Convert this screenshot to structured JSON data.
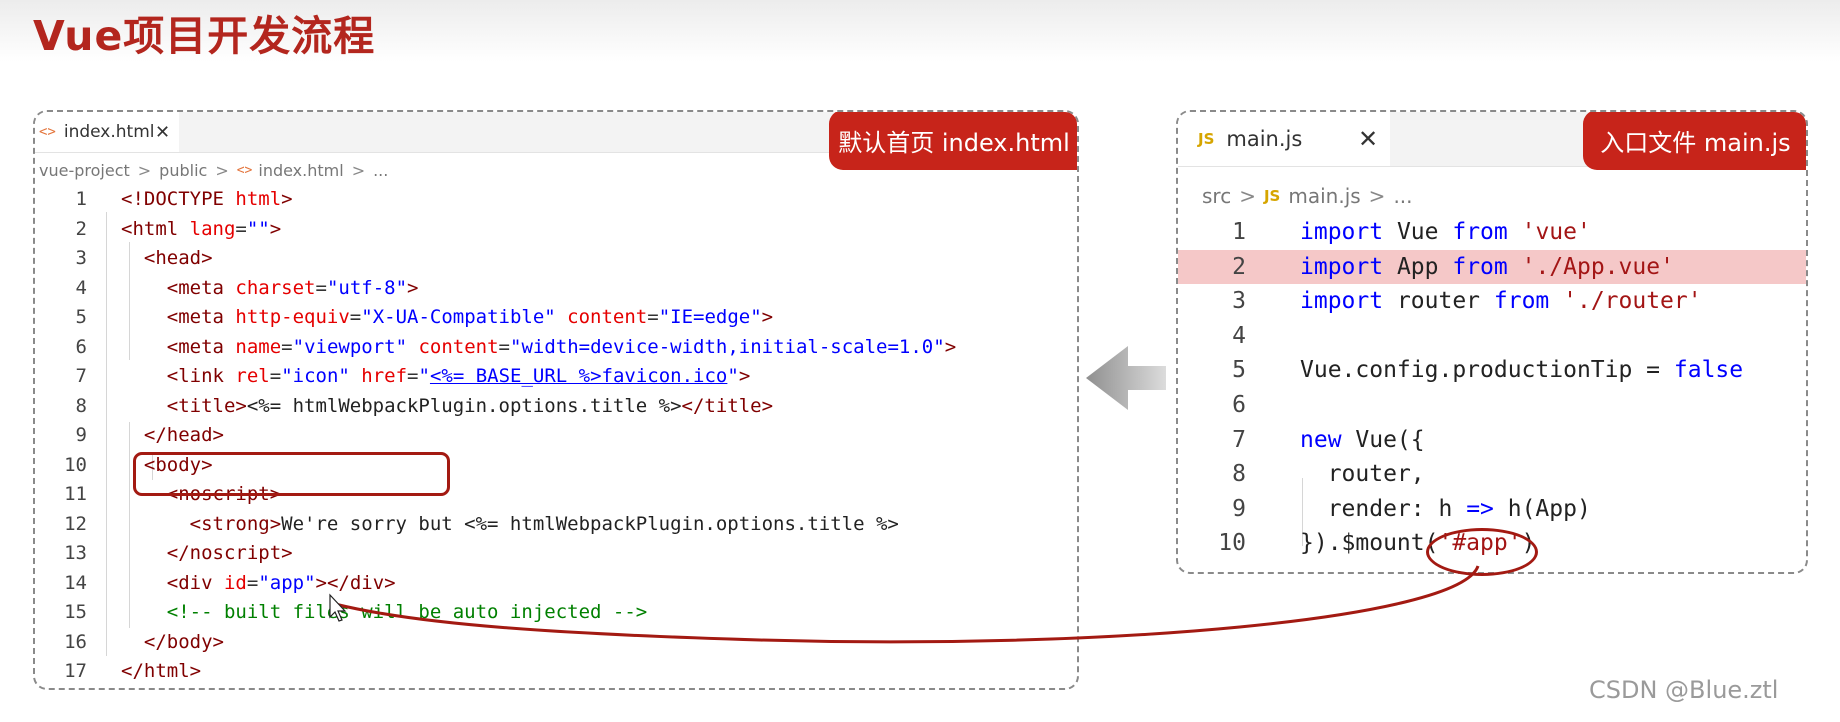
{
  "page_title": "Vue项目开发流程",
  "left_panel": {
    "tab_icon": "<>",
    "tab_label": "index.html",
    "tab_close": "✕",
    "badge": "默认首页 index.html",
    "breadcrumb": [
      "vue-project",
      "public",
      "index.html",
      "..."
    ],
    "breadcrumb_sep": ">",
    "lines": [
      {
        "n": "1",
        "tokens": [
          [
            "tag",
            "<!DOCTYPE "
          ],
          [
            "attr",
            "html"
          ],
          [
            "tag",
            ">"
          ]
        ]
      },
      {
        "n": "2",
        "tokens": [
          [
            "tag",
            "<html "
          ],
          [
            "attr",
            "lang"
          ],
          [
            "punct",
            "="
          ],
          [
            "str",
            "\"\""
          ],
          [
            "tag",
            ">"
          ]
        ]
      },
      {
        "n": "3",
        "indent": 1,
        "tokens": [
          [
            "tag",
            "<head>"
          ]
        ]
      },
      {
        "n": "4",
        "indent": 2,
        "tokens": [
          [
            "tag",
            "<meta "
          ],
          [
            "attr",
            "charset"
          ],
          [
            "punct",
            "="
          ],
          [
            "str",
            "\"utf-8\""
          ],
          [
            "tag",
            ">"
          ]
        ]
      },
      {
        "n": "5",
        "indent": 2,
        "tokens": [
          [
            "tag",
            "<meta "
          ],
          [
            "attr",
            "http-equiv"
          ],
          [
            "punct",
            "="
          ],
          [
            "str",
            "\"X-UA-Compatible\""
          ],
          [
            "plain",
            " "
          ],
          [
            "attr",
            "content"
          ],
          [
            "punct",
            "="
          ],
          [
            "str",
            "\"IE=edge\""
          ],
          [
            "tag",
            ">"
          ]
        ]
      },
      {
        "n": "6",
        "indent": 2,
        "tokens": [
          [
            "tag",
            "<meta "
          ],
          [
            "attr",
            "name"
          ],
          [
            "punct",
            "="
          ],
          [
            "str",
            "\"viewport\""
          ],
          [
            "plain",
            " "
          ],
          [
            "attr",
            "content"
          ],
          [
            "punct",
            "="
          ],
          [
            "str",
            "\"width=device-width,initial-scale=1.0\""
          ],
          [
            "tag",
            ">"
          ]
        ]
      },
      {
        "n": "7",
        "indent": 2,
        "tokens": [
          [
            "tag",
            "<link "
          ],
          [
            "attr",
            "rel"
          ],
          [
            "punct",
            "="
          ],
          [
            "str",
            "\"icon\""
          ],
          [
            "plain",
            " "
          ],
          [
            "attr",
            "href"
          ],
          [
            "punct",
            "="
          ],
          [
            "str",
            "\""
          ],
          [
            "link",
            "<%= BASE_URL %>favicon.ico"
          ],
          [
            "str",
            "\""
          ],
          [
            "tag",
            ">"
          ]
        ]
      },
      {
        "n": "8",
        "indent": 2,
        "tokens": [
          [
            "tag",
            "<title>"
          ],
          [
            "plain",
            "<%= htmlWebpackPlugin.options.title %>"
          ],
          [
            "tag",
            "</title>"
          ]
        ]
      },
      {
        "n": "9",
        "indent": 1,
        "tokens": [
          [
            "tag",
            "</head>"
          ]
        ]
      },
      {
        "n": "10",
        "indent": 1,
        "tokens": [
          [
            "tag",
            "<body>"
          ]
        ]
      },
      {
        "n": "11",
        "indent": 2,
        "tokens": [
          [
            "tag",
            "<noscript>"
          ]
        ]
      },
      {
        "n": "12",
        "indent": 3,
        "tokens": [
          [
            "tag",
            "<strong>"
          ],
          [
            "plain",
            "We're sorry but <%= htmlWebpackPlugin.options.title %>"
          ]
        ]
      },
      {
        "n": "13",
        "indent": 2,
        "tokens": [
          [
            "tag",
            "</noscript>"
          ]
        ]
      },
      {
        "n": "14",
        "indent": 2,
        "tokens": [
          [
            "tag",
            "<div "
          ],
          [
            "attr",
            "id"
          ],
          [
            "punct",
            "="
          ],
          [
            "str",
            "\"app\""
          ],
          [
            "tag",
            "></div>"
          ]
        ]
      },
      {
        "n": "15",
        "indent": 2,
        "tokens": [
          [
            "cmt",
            "<!-- built files will be auto injected -->"
          ]
        ]
      },
      {
        "n": "16",
        "indent": 1,
        "tokens": [
          [
            "tag",
            "</body>"
          ]
        ]
      },
      {
        "n": "17",
        "tokens": [
          [
            "tag",
            "</html>"
          ]
        ]
      }
    ]
  },
  "right_panel": {
    "tab_icon": "JS",
    "tab_label": "main.js",
    "tab_close": "✕",
    "badge": "入口文件 main.js",
    "breadcrumb": [
      "src",
      "main.js",
      "..."
    ],
    "breadcrumb_sep": ">",
    "lines": [
      {
        "n": "1",
        "tokens": [
          [
            "kw",
            "import"
          ],
          [
            "plain",
            " Vue "
          ],
          [
            "kw",
            "from"
          ],
          [
            "plain",
            " "
          ],
          [
            "jsstr",
            "'vue'"
          ]
        ]
      },
      {
        "n": "2",
        "highlight": true,
        "tokens": [
          [
            "kw",
            "import"
          ],
          [
            "plain",
            " App "
          ],
          [
            "kw",
            "from"
          ],
          [
            "plain",
            " "
          ],
          [
            "jsstr",
            "'./App.vue'"
          ]
        ]
      },
      {
        "n": "3",
        "tokens": [
          [
            "kw",
            "import"
          ],
          [
            "plain",
            " router "
          ],
          [
            "kw",
            "from"
          ],
          [
            "plain",
            " "
          ],
          [
            "jsstr",
            "'./router'"
          ]
        ]
      },
      {
        "n": "4",
        "tokens": []
      },
      {
        "n": "5",
        "tokens": [
          [
            "plain",
            "Vue.config.productionTip = "
          ],
          [
            "kw",
            "false"
          ]
        ]
      },
      {
        "n": "6",
        "tokens": []
      },
      {
        "n": "7",
        "tokens": [
          [
            "kw",
            "new"
          ],
          [
            "plain",
            " Vue({"
          ]
        ]
      },
      {
        "n": "8",
        "indent": 1,
        "tokens": [
          [
            "plain",
            "router,"
          ]
        ]
      },
      {
        "n": "9",
        "indent": 1,
        "tokens": [
          [
            "plain",
            "render: h "
          ],
          [
            "kw",
            "=>"
          ],
          [
            "plain",
            " h(App)"
          ]
        ]
      },
      {
        "n": "10",
        "tokens": [
          [
            "plain",
            "}).$mount("
          ],
          [
            "jsstr",
            "'#app'"
          ],
          [
            "plain",
            ")"
          ]
        ]
      }
    ]
  },
  "watermark": "CSDN @Blue.ztl",
  "colors": {
    "accent": "#c7241a",
    "title": "#b3261e",
    "highlight_row": "#f5c8c8",
    "arrow": "#9a9a9a"
  },
  "icons": [
    "html-file-icon",
    "js-file-icon",
    "close-icon",
    "left-arrow-icon"
  ]
}
